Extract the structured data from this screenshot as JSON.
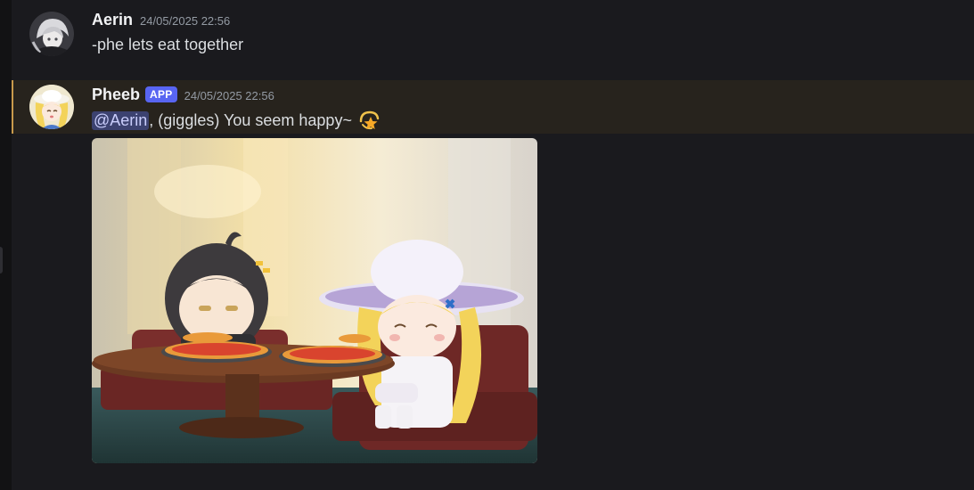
{
  "messages": [
    {
      "author": "Aerin",
      "timestamp": "24/05/2025 22:56",
      "text": "-phe lets eat together"
    },
    {
      "author": "Pheeb",
      "badge": "APP",
      "timestamp": "24/05/2025 22:56",
      "mention": "@Aerin",
      "text": ", (giggles) You seem happy~",
      "emoji": "dizzy-star-icon",
      "attachment": {
        "type": "image",
        "description_icon": "pizza-dinner-image"
      }
    }
  ],
  "colors": {
    "background": "#1a1a1e",
    "highlight": "#27231d",
    "highlight_border": "#c89a4c",
    "mention_bg": "#3c4270",
    "app_badge": "#5865f2"
  }
}
